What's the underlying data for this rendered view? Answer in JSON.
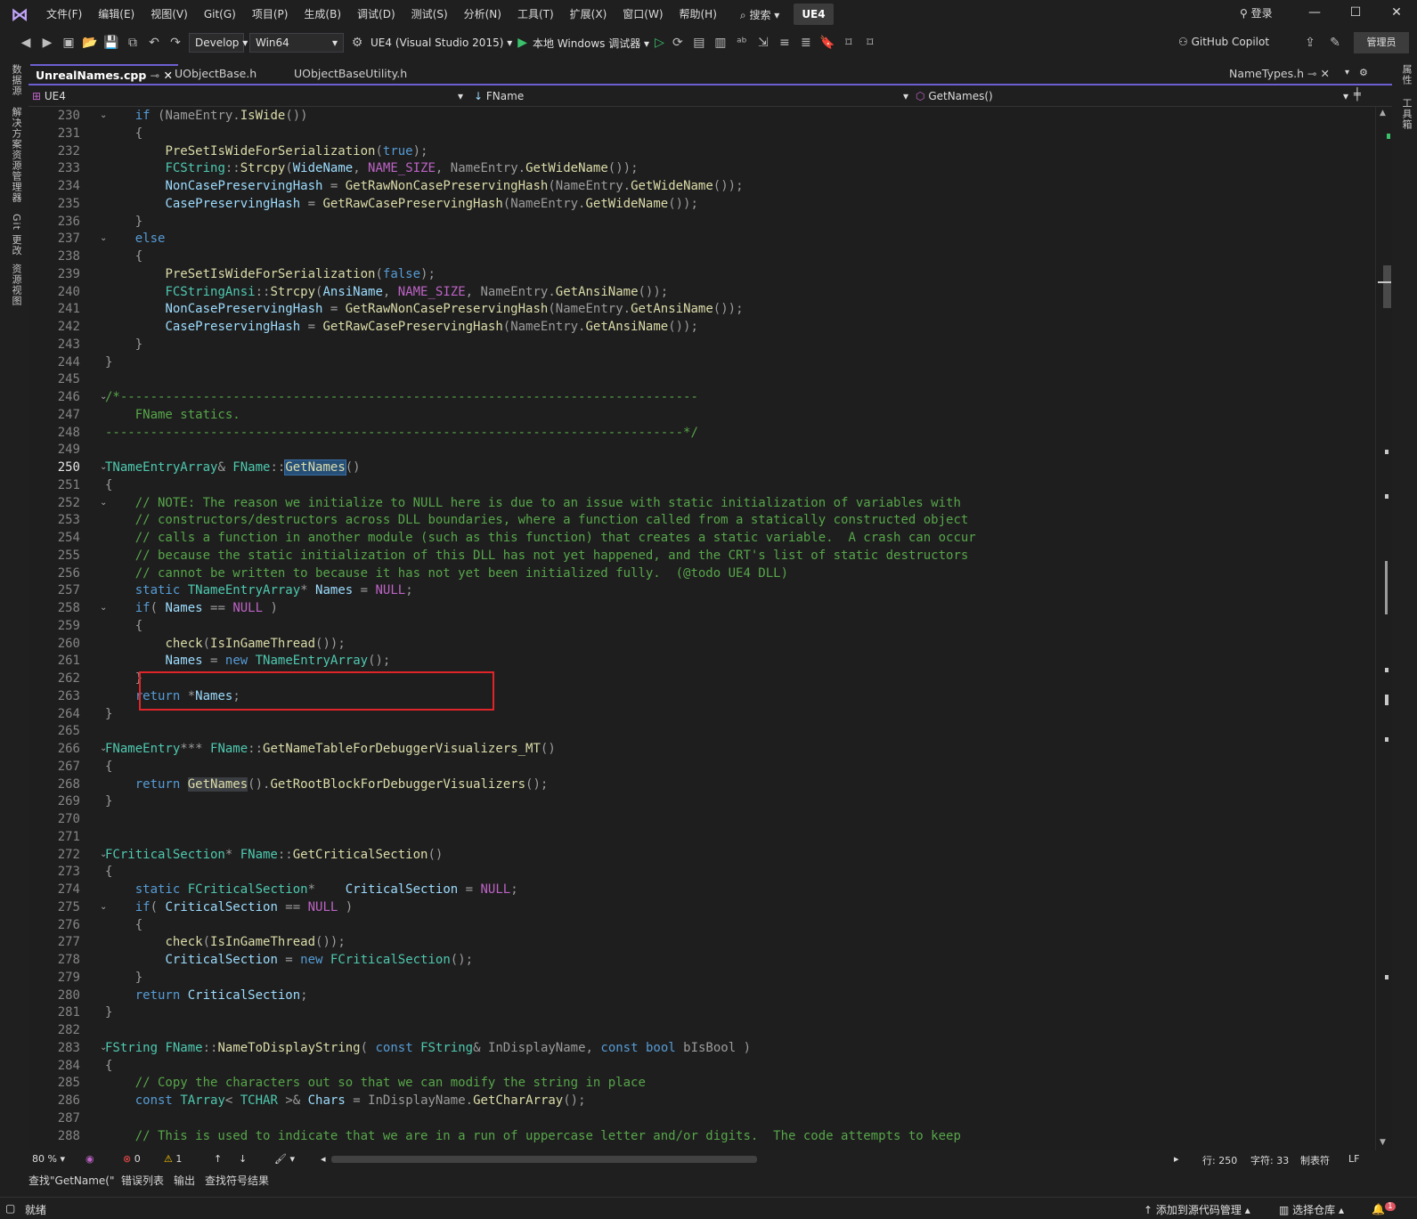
{
  "menubar": {
    "logo": "VS",
    "items": [
      "文件(F)",
      "编辑(E)",
      "视图(V)",
      "Git(G)",
      "项目(P)",
      "生成(B)",
      "调试(D)",
      "测试(S)",
      "分析(N)",
      "工具(T)",
      "扩展(X)",
      "窗口(W)",
      "帮助(H)"
    ],
    "search": "搜索",
    "solution_badge": "UE4",
    "login": "登录"
  },
  "toolbar": {
    "config": "Develop",
    "platform": "Win64",
    "project": "UE4 (Visual Studio 2015)",
    "debugger": "本地 Windows 调试器",
    "copilot": "GitHub Copilot",
    "admin": "管理员"
  },
  "siderail": {
    "left": [
      "数据源",
      "解决方案资源管理器",
      "Git 更改",
      "资源视图"
    ],
    "right": [
      "属性",
      "工具箱"
    ]
  },
  "tabs": [
    {
      "label": "UnrealNames.cpp",
      "active": true
    },
    {
      "label": "UObjectBase.h",
      "active": false
    },
    {
      "label": "UObjectBaseUtility.h",
      "active": false
    },
    {
      "label": "NameTypes.h",
      "active": false
    }
  ],
  "navbar": {
    "project": "UE4",
    "scope": "FName",
    "member": "GetNames()"
  },
  "editor": {
    "current_line": 250,
    "lines": [
      {
        "n": 230,
        "t": "    if (NameEntry.IsWide())"
      },
      {
        "n": 231,
        "t": "    {"
      },
      {
        "n": 232,
        "t": "        PreSetIsWideForSerialization(true);"
      },
      {
        "n": 233,
        "t": "        FCString::Strcpy(WideName, NAME_SIZE, NameEntry.GetWideName());"
      },
      {
        "n": 234,
        "t": "        NonCasePreservingHash = GetRawNonCasePreservingHash(NameEntry.GetWideName());"
      },
      {
        "n": 235,
        "t": "        CasePreservingHash = GetRawCasePreservingHash(NameEntry.GetWideName());"
      },
      {
        "n": 236,
        "t": "    }"
      },
      {
        "n": 237,
        "t": "    else"
      },
      {
        "n": 238,
        "t": "    {"
      },
      {
        "n": 239,
        "t": "        PreSetIsWideForSerialization(false);"
      },
      {
        "n": 240,
        "t": "        FCStringAnsi::Strcpy(AnsiName, NAME_SIZE, NameEntry.GetAnsiName());"
      },
      {
        "n": 241,
        "t": "        NonCasePreservingHash = GetRawNonCasePreservingHash(NameEntry.GetAnsiName());"
      },
      {
        "n": 242,
        "t": "        CasePreservingHash = GetRawCasePreservingHash(NameEntry.GetAnsiName());"
      },
      {
        "n": 243,
        "t": "    }"
      },
      {
        "n": 244,
        "t": "}"
      },
      {
        "n": 245,
        "t": ""
      },
      {
        "n": 246,
        "t": "/*-----------------------------------------------------------------------------"
      },
      {
        "n": 247,
        "t": "    FName statics."
      },
      {
        "n": 248,
        "t": "-----------------------------------------------------------------------------*/"
      },
      {
        "n": 249,
        "t": ""
      },
      {
        "n": 250,
        "t": "TNameEntryArray& FName::GetNames()"
      },
      {
        "n": 251,
        "t": "{"
      },
      {
        "n": 252,
        "t": "    // NOTE: The reason we initialize to NULL here is due to an issue with static initialization of variables with"
      },
      {
        "n": 253,
        "t": "    // constructors/destructors across DLL boundaries, where a function called from a statically constructed object"
      },
      {
        "n": 254,
        "t": "    // calls a function in another module (such as this function) that creates a static variable.  A crash can occur"
      },
      {
        "n": 255,
        "t": "    // because the static initialization of this DLL has not yet happened, and the CRT's list of static destructors"
      },
      {
        "n": 256,
        "t": "    // cannot be written to because it has not yet been initialized fully.  (@todo UE4 DLL)"
      },
      {
        "n": 257,
        "t": "    static TNameEntryArray* Names = NULL;"
      },
      {
        "n": 258,
        "t": "    if( Names == NULL )"
      },
      {
        "n": 259,
        "t": "    {"
      },
      {
        "n": 260,
        "t": "        check(IsInGameThread());"
      },
      {
        "n": 261,
        "t": "        Names = new TNameEntryArray();"
      },
      {
        "n": 262,
        "t": "    }"
      },
      {
        "n": 263,
        "t": "    return *Names;"
      },
      {
        "n": 264,
        "t": "}"
      },
      {
        "n": 265,
        "t": ""
      },
      {
        "n": 266,
        "t": "FNameEntry*** FName::GetNameTableForDebuggerVisualizers_MT()"
      },
      {
        "n": 267,
        "t": "{"
      },
      {
        "n": 268,
        "t": "    return GetNames().GetRootBlockForDebuggerVisualizers();"
      },
      {
        "n": 269,
        "t": "}"
      },
      {
        "n": 270,
        "t": ""
      },
      {
        "n": 271,
        "t": ""
      },
      {
        "n": 272,
        "t": "FCriticalSection* FName::GetCriticalSection()"
      },
      {
        "n": 273,
        "t": "{"
      },
      {
        "n": 274,
        "t": "    static FCriticalSection*    CriticalSection = NULL;"
      },
      {
        "n": 275,
        "t": "    if( CriticalSection == NULL )"
      },
      {
        "n": 276,
        "t": "    {"
      },
      {
        "n": 277,
        "t": "        check(IsInGameThread());"
      },
      {
        "n": 278,
        "t": "        CriticalSection = new FCriticalSection();"
      },
      {
        "n": 279,
        "t": "    }"
      },
      {
        "n": 280,
        "t": "    return CriticalSection;"
      },
      {
        "n": 281,
        "t": "}"
      },
      {
        "n": 282,
        "t": ""
      },
      {
        "n": 283,
        "t": "FString FName::NameToDisplayString( const FString& InDisplayName, const bool bIsBool )"
      },
      {
        "n": 284,
        "t": "{"
      },
      {
        "n": 285,
        "t": "    // Copy the characters out so that we can modify the string in place"
      },
      {
        "n": 286,
        "t": "    const TArray< TCHAR >& Chars = InDisplayName.GetCharArray();"
      },
      {
        "n": 287,
        "t": ""
      },
      {
        "n": 288,
        "t": "    // This is used to indicate that we are in a run of uppercase letter and/or digits.  The code attempts to keep"
      }
    ]
  },
  "editor_status": {
    "zoom": "80 %",
    "errors": "0",
    "warnings": "1",
    "line": "行: 250",
    "col": "字符: 33",
    "tabs": "制表符",
    "eol": "LF"
  },
  "panel_tabs": [
    "查找\"GetName(\"",
    "错误列表",
    "输出",
    "查找符号结果"
  ],
  "statusbar": {
    "ready": "就绪",
    "source_control": "添加到源代码管理",
    "repo": "选择仓库",
    "notifications": "1"
  }
}
